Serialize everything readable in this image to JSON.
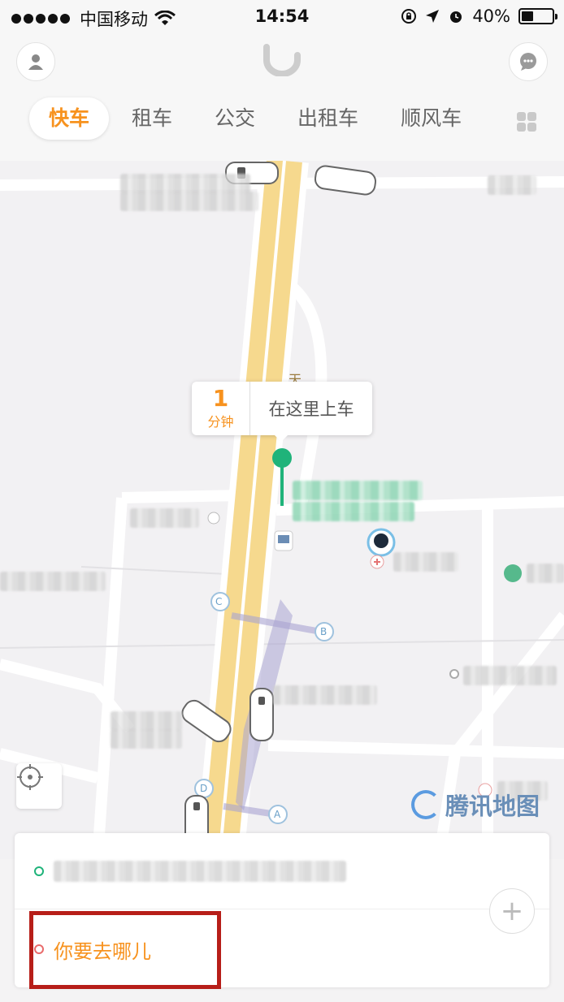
{
  "status_bar": {
    "carrier": "中国移动",
    "time": "14:54",
    "battery": "40%",
    "battery_level": 0.4
  },
  "header": {
    "logo_icon": "didi-logo-icon",
    "profile_icon": "user-icon",
    "message_icon": "chat-icon",
    "tabs": [
      {
        "label": "快车",
        "active": true
      },
      {
        "label": "租车"
      },
      {
        "label": "公交"
      },
      {
        "label": "出租车"
      },
      {
        "label": "顺风车"
      }
    ],
    "more_icon": "grid-icon"
  },
  "map": {
    "pickup": {
      "eta_value": "1",
      "eta_unit": "分钟",
      "label": "在这里上车"
    },
    "road_label": "天",
    "stop_letters": [
      "A",
      "B",
      "C",
      "D"
    ],
    "watermark": "腾讯地图"
  },
  "colors": {
    "accent": "#f7921e",
    "start_dot": "#1fb37a",
    "dest_dot": "#e96b6b",
    "highlight": "#b71e19"
  },
  "booking": {
    "destination_placeholder": "你要去哪儿",
    "add_stop_symbol": "+"
  }
}
